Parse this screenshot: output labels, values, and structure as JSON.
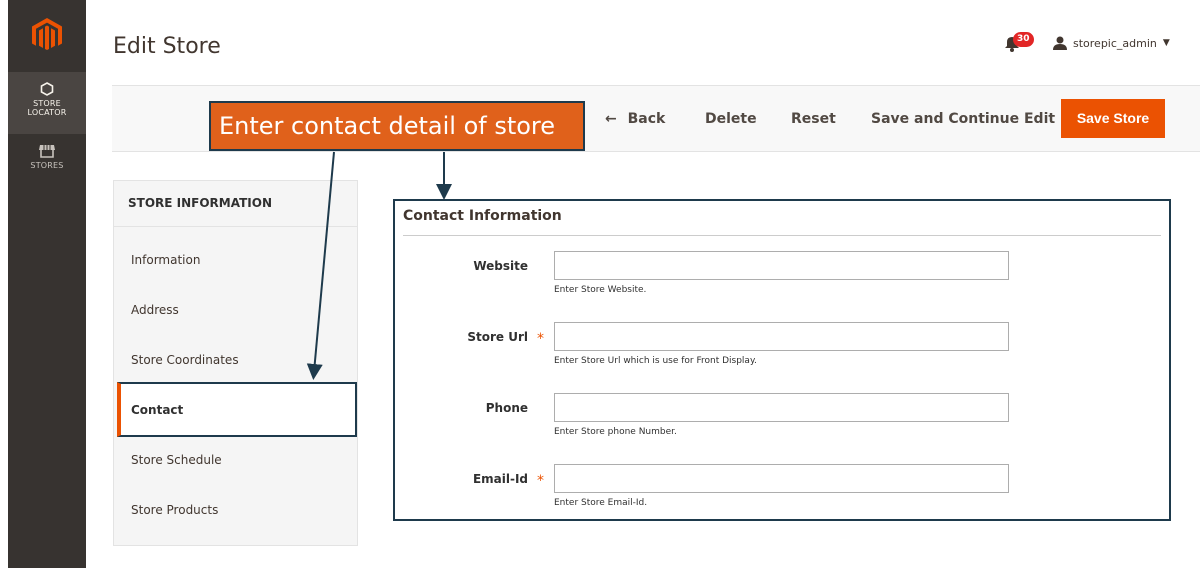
{
  "nav": {
    "items": [
      {
        "label": "STORE\nLOCATOR",
        "line1": "STORE",
        "line2": "LOCATOR"
      },
      {
        "label": "STORES"
      }
    ]
  },
  "header": {
    "title": "Edit Store",
    "notification_count": "30",
    "user_name": "storepic_admin"
  },
  "actions": {
    "back": "Back",
    "delete": "Delete",
    "reset": "Reset",
    "save_continue": "Save and Continue Edit",
    "save": "Save Store"
  },
  "callout": {
    "text": "Enter contact detail of store"
  },
  "sidebar": {
    "title": "STORE INFORMATION",
    "items": [
      {
        "label": "Information"
      },
      {
        "label": "Address"
      },
      {
        "label": "Store Coordinates"
      },
      {
        "label": "Contact"
      },
      {
        "label": "Store Schedule"
      },
      {
        "label": "Store Products"
      }
    ]
  },
  "form": {
    "section_title": "Contact Information",
    "fields": [
      {
        "label": "Website",
        "value": "",
        "note": "Enter Store Website.",
        "required": false
      },
      {
        "label": "Store Url",
        "value": "",
        "note": "Enter Store Url which is use for Front Display.",
        "required": true
      },
      {
        "label": "Phone",
        "value": "",
        "note": "Enter Store phone Number.",
        "required": false
      },
      {
        "label": "Email-Id",
        "value": "",
        "note": "Enter Store Email-Id.",
        "required": true
      }
    ]
  },
  "colors": {
    "nav_bg": "#373330",
    "accent": "#eb5202",
    "callout_bg": "#e0611b",
    "annotation": "#1e3a4c",
    "badge": "#e22626"
  }
}
